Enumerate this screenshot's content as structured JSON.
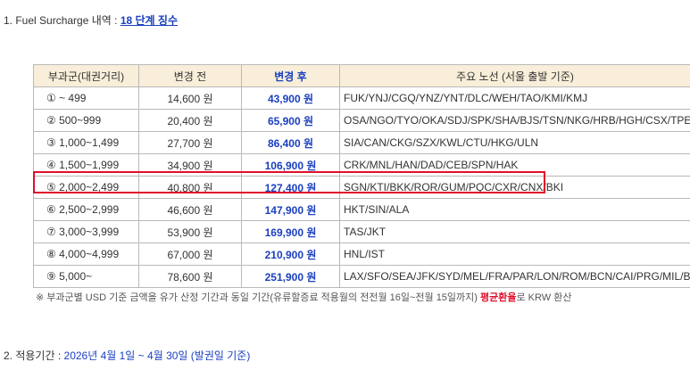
{
  "section1": {
    "prefix": "1. Fuel Surcharge 내역 : ",
    "link_text": "18 단계 징수"
  },
  "table": {
    "headers": {
      "band": "부과군(대권거리)",
      "before": "변경 전",
      "after": "변경 후",
      "routes": "주요 노선 (서울 출발 기준)"
    },
    "rows": [
      {
        "band": "① ~ 499",
        "before": "14,600 원",
        "after": "43,900 원",
        "routes": "FUK/YNJ/CGQ/YNZ/YNT/DLC/WEH/TAO/KMI/KMJ"
      },
      {
        "band": "② 500~999",
        "before": "20,400 원",
        "after": "65,900 원",
        "routes": "OSA/NGO/TYO/OKA/SDJ/SPK/SHA/BJS/TSN/NKG/HRB/HGH/CSX/TPE/AKJ"
      },
      {
        "band": "③ 1,000~1,499",
        "before": "27,700 원",
        "after": "86,400 원",
        "routes": "SIA/CAN/CKG/SZX/KWL/CTU/HKG/ULN"
      },
      {
        "band": "④ 1,500~1,999",
        "before": "34,900 원",
        "after": "106,900 원",
        "routes": "CRK/MNL/HAN/DAD/CEB/SPN/HAK"
      },
      {
        "band": "⑤ 2,000~2,499",
        "before": "40,800 원",
        "after": "127,400 원",
        "routes": "SGN/KTI/BKK/ROR/GUM/PQC/CXR/CNX/BKI"
      },
      {
        "band": "⑥ 2,500~2,999",
        "before": "46,600 원",
        "after": "147,900 원",
        "routes": "HKT/SIN/ALA"
      },
      {
        "band": "⑦ 3,000~3,999",
        "before": "53,900 원",
        "after": "169,900 원",
        "routes": "TAS/JKT"
      },
      {
        "band": "⑧ 4,000~4,999",
        "before": "67,000 원",
        "after": "210,900 원",
        "routes": "HNL/IST"
      },
      {
        "band": "⑨ 5,000~",
        "before": "78,600 원",
        "after": "251,900 원",
        "routes": "LAX/SFO/SEA/JFK/SYD/MEL/FRA/PAR/LON/ROM/BCN/CAI/PRG/MIL/BUD"
      }
    ]
  },
  "note": {
    "part1": "※ 부과군별 USD 기준 금액을 유가 산정 기간과 동일 기간(유류할증료 적용월의 전전월 16일~전월 15일까지) ",
    "highlight": "평균환율",
    "part2": "로 KRW 환산"
  },
  "section2": {
    "prefix": "2. 적용기간 : ",
    "period": "2026년 4월 1일 ~ 4월 30일 (발권일 기준)"
  },
  "colors": {
    "accent_blue": "#1a3fbf",
    "highlight_red": "#e0102b",
    "header_bg": "#f8eed9",
    "border": "#b9b9b9"
  }
}
